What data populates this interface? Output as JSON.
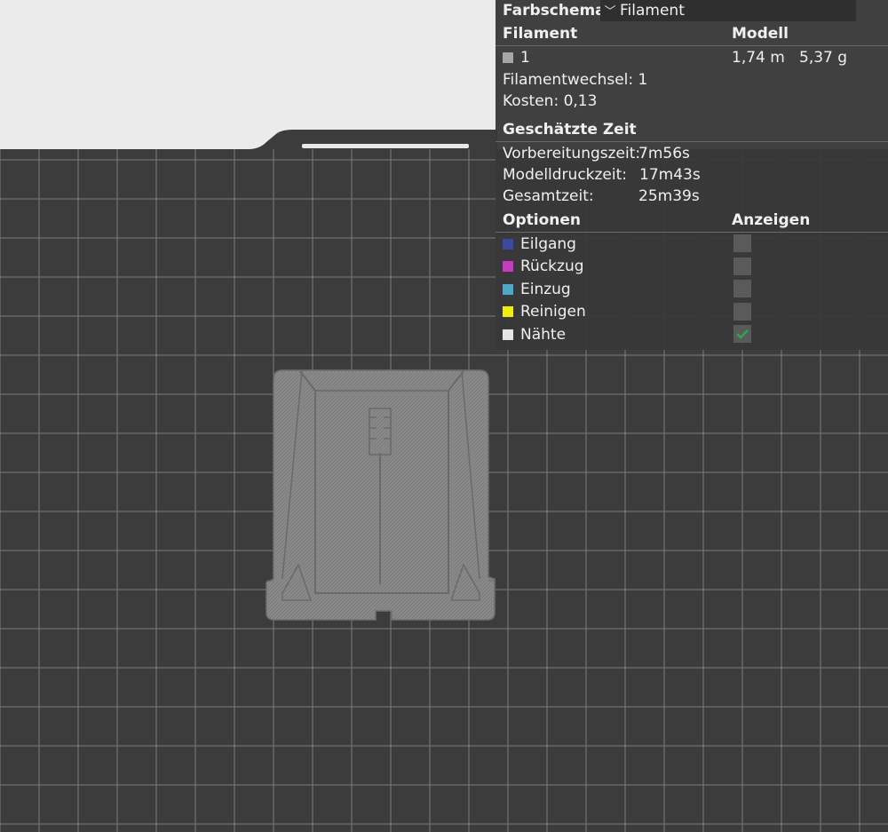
{
  "colors": {
    "bed": "#3c3c3c",
    "grid": "#7d7d7d",
    "part": "#8a8a8a",
    "panel_bg": "#383838",
    "check_green": "#2aa845"
  },
  "panel": {
    "color_scheme_label": "Farbschema",
    "color_scheme_value": "Filament",
    "dropdown_icon": "chevron-down-icon",
    "filament_header": "Filament",
    "model_header": "Modell",
    "filament_row": {
      "index": "1",
      "length": "1,74 m",
      "weight": "5,37 g",
      "swatch": "#a6a6a6"
    },
    "filament_changes": "Filamentwechsel: 1",
    "cost": "Kosten: 0,13",
    "est_time_header": "Geschätzte Zeit",
    "prep_label": "Vorbereitungszeit:",
    "prep_value": "7m56s",
    "model_time_label": "Modelldruckzeit:",
    "model_time_value": "17m43s",
    "total_label": "Gesamtzeit:",
    "total_value": "25m39s",
    "options_header": "Optionen",
    "show_header": "Anzeigen",
    "options": [
      {
        "label": "Eilgang",
        "color": "#3a4aa0",
        "checked": false
      },
      {
        "label": "Rückzug",
        "color": "#c43cc4",
        "checked": false
      },
      {
        "label": "Einzug",
        "color": "#4aa8c8",
        "checked": false
      },
      {
        "label": "Reinigen",
        "color": "#f0f000",
        "checked": false
      },
      {
        "label": "Nähte",
        "color": "#e6e6e6",
        "checked": true
      }
    ]
  }
}
